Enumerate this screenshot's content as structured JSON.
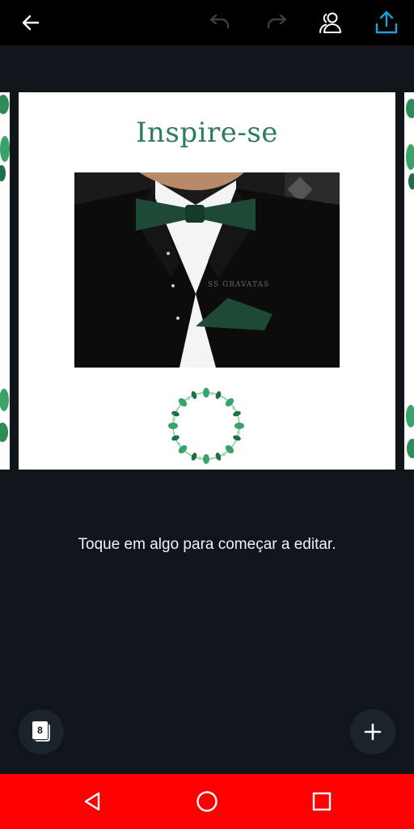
{
  "toolbar": {
    "back_icon": "arrow-left-icon",
    "undo_icon": "undo-icon",
    "redo_icon": "redo-icon",
    "share_people_icon": "people-icon",
    "export_icon": "upload-icon"
  },
  "design": {
    "title": "Inspire-se",
    "photo_watermark": "SS GRAVATAS",
    "title_color": "#2d7a5c"
  },
  "hint_text": "Toque em algo para começar a editar.",
  "pages_button": {
    "count": "8"
  },
  "add_button": {
    "icon": "plus-icon"
  },
  "system_nav": {
    "back_icon": "triangle-back-icon",
    "home_icon": "circle-home-icon",
    "recents_icon": "square-recents-icon",
    "bar_color": "#ff0000"
  }
}
